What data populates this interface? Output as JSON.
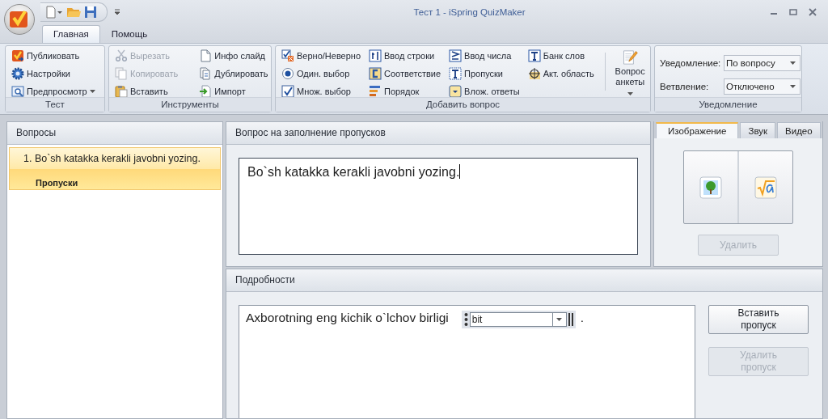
{
  "window": {
    "title": "Тест 1 - iSpring QuizMaker"
  },
  "ribbon_tabs": [
    {
      "label": "Главная",
      "selected": true
    },
    {
      "label": "Помощь",
      "selected": false
    }
  ],
  "ribbon_groups": [
    {
      "title": "Тест",
      "kind": "buttons",
      "columns": [
        [
          {
            "label": "Публиковать",
            "kind": "publish",
            "disabled": false,
            "dropdown": false
          },
          {
            "label": "Настройки",
            "kind": "gear",
            "disabled": false,
            "dropdown": false
          },
          {
            "label": "Предпросмотр",
            "kind": "preview",
            "disabled": false,
            "dropdown": true
          }
        ]
      ]
    },
    {
      "title": "Инструменты",
      "kind": "buttons",
      "columns": [
        [
          {
            "label": "Вырезать",
            "kind": "scissors",
            "disabled": true,
            "dropdown": false
          },
          {
            "label": "Копировать",
            "kind": "copy",
            "disabled": true,
            "dropdown": false
          },
          {
            "label": "Вставить",
            "kind": "paste",
            "disabled": false,
            "dropdown": false
          }
        ],
        [
          {
            "label": "Инфо слайд",
            "kind": "page",
            "disabled": false,
            "dropdown": false
          },
          {
            "label": "Дублировать",
            "kind": "duplicate",
            "disabled": false,
            "dropdown": false
          },
          {
            "label": "Импорт",
            "kind": "import",
            "disabled": false,
            "dropdown": false
          }
        ]
      ]
    },
    {
      "title": "Добавить вопрос",
      "kind": "buttons",
      "columns": [
        [
          {
            "label": "Верно/Неверно",
            "kind": "truefalse",
            "disabled": false,
            "dropdown": false
          },
          {
            "label": "Один. выбор",
            "kind": "radio",
            "disabled": false,
            "dropdown": false
          },
          {
            "label": "Множ. выбор",
            "kind": "check",
            "disabled": false,
            "dropdown": false
          }
        ],
        [
          {
            "label": "Ввод строки",
            "kind": "textcursor",
            "disabled": false,
            "dropdown": false
          },
          {
            "label": "Соответствие",
            "kind": "match",
            "disabled": false,
            "dropdown": false
          },
          {
            "label": "Порядок",
            "kind": "order",
            "disabled": false,
            "dropdown": false
          }
        ],
        [
          {
            "label": "Ввод числа",
            "kind": "number",
            "disabled": false,
            "dropdown": false
          },
          {
            "label": "Пропуски",
            "kind": "blanks",
            "disabled": false,
            "dropdown": false
          },
          {
            "label": "Влож. ответы",
            "kind": "combo",
            "disabled": false,
            "dropdown": false
          }
        ],
        [
          {
            "label": "Банк слов",
            "kind": "wordbank",
            "disabled": false,
            "dropdown": false
          },
          {
            "label": "Акт. область",
            "kind": "target",
            "disabled": false,
            "dropdown": false
          }
        ]
      ],
      "large_button": {
        "label": "Вопрос анкеты",
        "dropdown": true
      }
    },
    {
      "title": "Уведомление",
      "kind": "fields",
      "fields": [
        {
          "label": "Уведомление:",
          "value": "По вопросу"
        },
        {
          "label": "Ветвление:",
          "value": "Отключено"
        }
      ]
    }
  ],
  "questions": {
    "title": "Вопросы",
    "items": [
      {
        "number": "1.",
        "text": "Bo`sh katakka kerakli javobni yozing.",
        "type": "Пропуски",
        "selected": true
      }
    ]
  },
  "question_editor": {
    "title": "Вопрос на заполнение пропусков",
    "text": "Bo`sh katakka kerakli javobni yozing."
  },
  "media": {
    "tabs": [
      {
        "label": "Изображение",
        "selected": true
      },
      {
        "label": "Звук",
        "selected": false
      },
      {
        "label": "Видео",
        "selected": false
      }
    ],
    "delete_button": {
      "label": "Удалить",
      "disabled": true
    }
  },
  "details": {
    "title": "Подробности",
    "text_before": "Axborotning eng kichik o`lchov birligi",
    "blank_value": "bit",
    "text_after": ".",
    "buttons": [
      {
        "label": "Вставить пропуск",
        "disabled": false
      },
      {
        "label": "Удалить пропуск",
        "disabled": true
      }
    ]
  }
}
